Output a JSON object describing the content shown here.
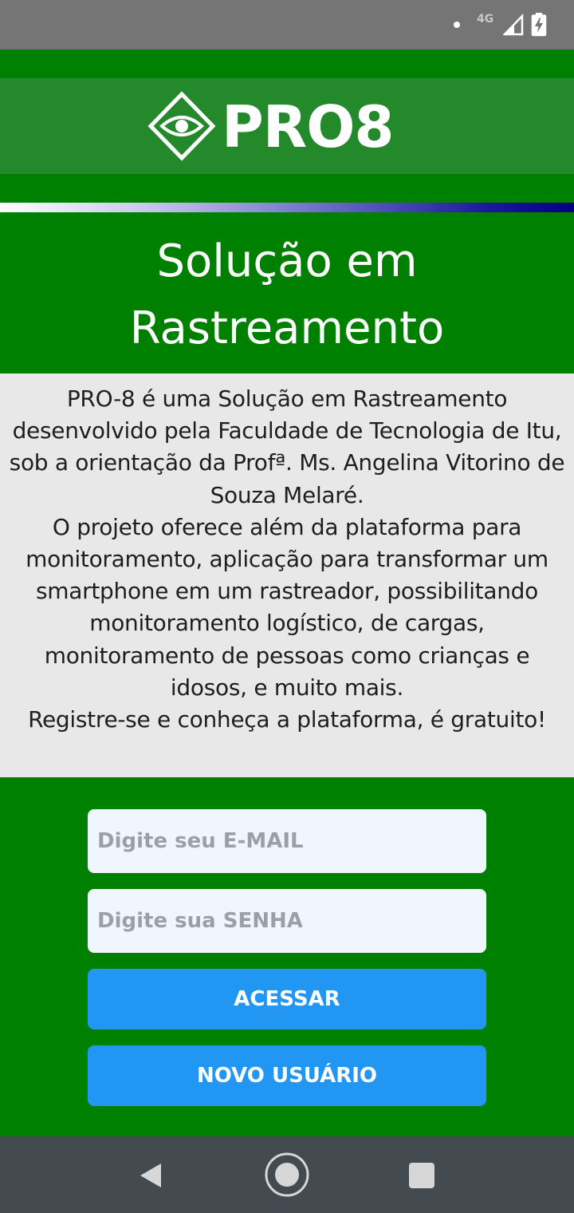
{
  "status_bar": {
    "network_label": "4G",
    "icons": [
      "notification-dot-icon",
      "signal-icon",
      "battery-charging-icon"
    ]
  },
  "header": {
    "logo_text": "PRO8",
    "logo_icon": "eye-diamond-icon"
  },
  "title": "Solução em Rastreamento",
  "description": "PRO-8 é uma Solução em Rastreamento desenvolvido pela Faculdade de Tecnologia de Itu, sob a orientação da Profª. Ms. Angelina Vitorino de Souza Melaré.\nO projeto oferece além da plataforma para monitoramento, aplicação para transformar um smartphone em um rastreador, possibilitando monitoramento logístico, de cargas, monitoramento de pessoas como crianças e idosos, e muito mais.\nRegistre-se e conheça a plataforma, é gratuito!",
  "form": {
    "email_placeholder": "Digite seu E-MAIL",
    "email_value": "",
    "password_placeholder": "Digite sua SENHA",
    "password_value": "",
    "login_label": "ACESSAR",
    "register_label": "NOVO USUÁRIO"
  },
  "navigation": {
    "icons": [
      "back-icon",
      "home-icon",
      "recents-icon"
    ]
  },
  "colors": {
    "primary_green": "#008000",
    "logo_band": "#23892a",
    "description_bg": "#e8e8e8",
    "button_blue": "#2196f3",
    "input_bg": "#f0f6fe",
    "status_bar": "#757575",
    "nav_bar": "#434a50",
    "gradient_end": "#000080"
  }
}
